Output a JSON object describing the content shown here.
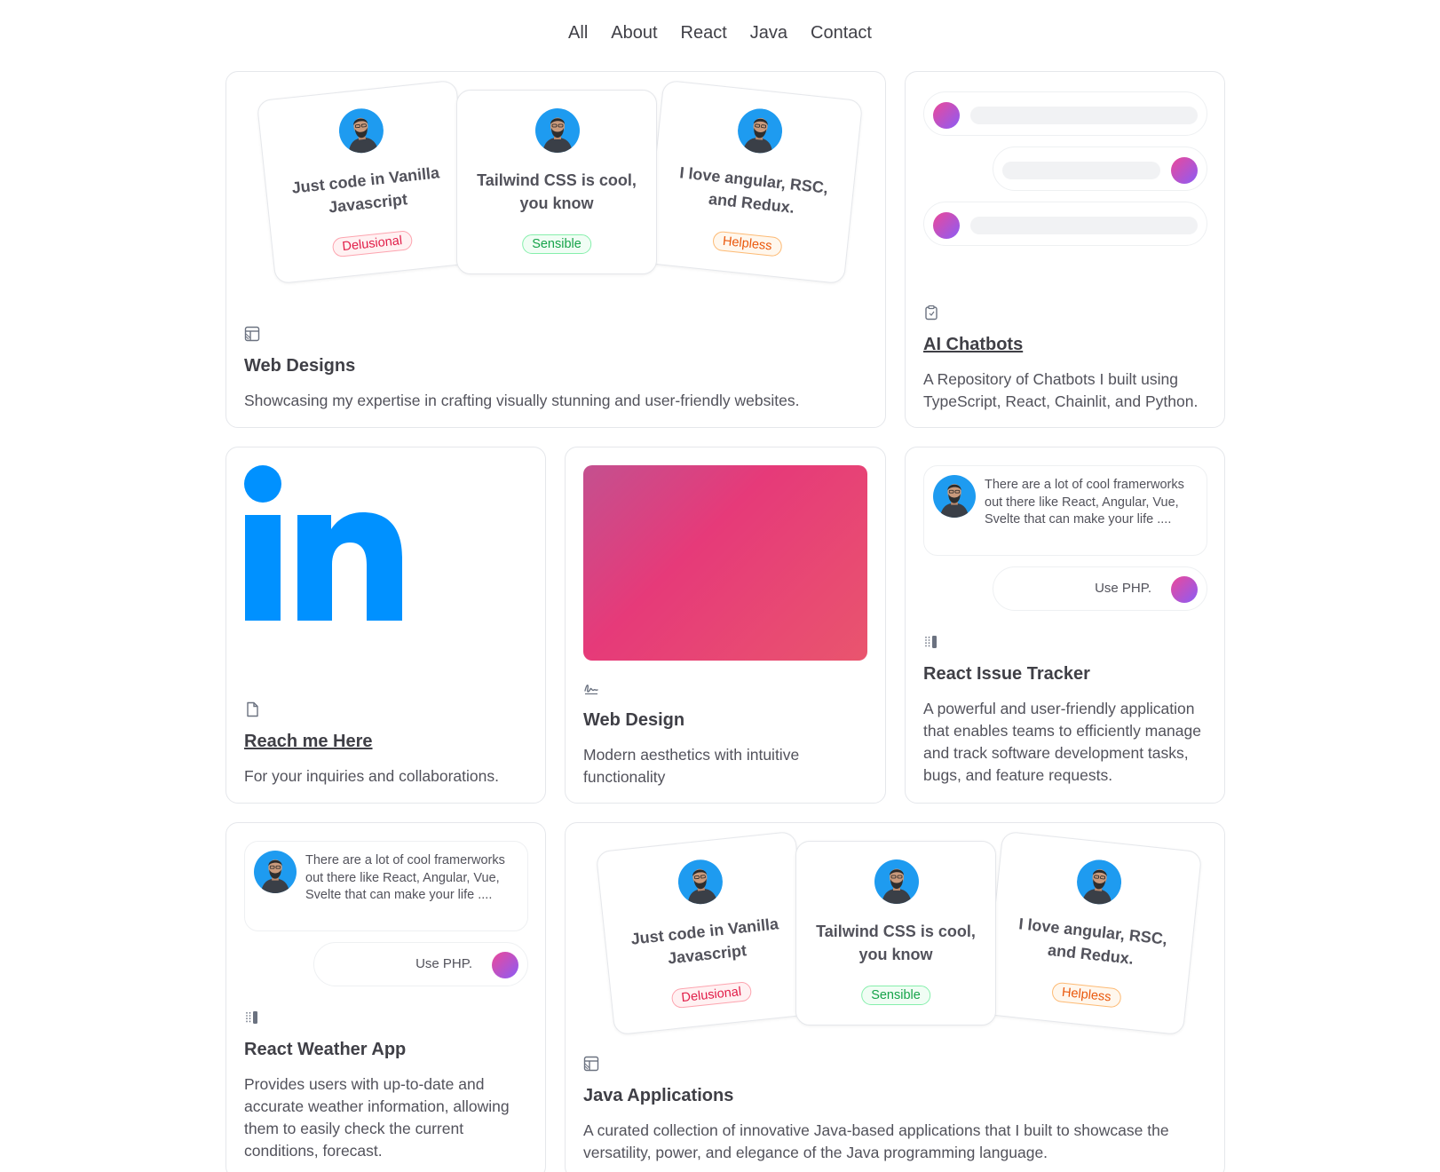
{
  "nav": {
    "items": [
      "All",
      "About",
      "React",
      "Java",
      "Contact"
    ]
  },
  "profile_cards": [
    {
      "text": "Just code in Vanilla Javascript",
      "badge": "Delusional"
    },
    {
      "text": "Tailwind CSS is cool, you know",
      "badge": "Sensible"
    },
    {
      "text": "I love angular, RSC, and Redux.",
      "badge": "Helpless"
    }
  ],
  "cards": {
    "web_designs": {
      "icon": "table-layout-icon",
      "title": "Web Designs",
      "desc": "Showcasing my expertise in crafting visually stunning and user-friendly websites."
    },
    "ai_chatbots": {
      "icon": "clipboard-icon",
      "title": "AI Chatbots",
      "desc": "A Repository of Chatbots I built using TypeScript, React, Chainlit, and Python."
    },
    "reach_me": {
      "icon": "file-icon",
      "title": "Reach me Here",
      "desc": "For your inquiries and collaborations.",
      "logo": "in"
    },
    "web_design": {
      "icon": "signature-icon",
      "title": "Web Design",
      "desc": "Modern aesthetics with intuitive functionality"
    },
    "react_issue": {
      "icon": "side-panel-icon",
      "title": "React Issue Tracker",
      "desc": "A powerful and user-friendly application that enables teams to efficiently manage and track software development tasks, bugs, and feature requests."
    },
    "react_weather": {
      "icon": "side-panel-icon",
      "title": "React Weather App",
      "desc": "Provides users with up-to-date and accurate weather information, allowing them to easily check the current conditions, forecast."
    },
    "java_apps": {
      "icon": "table-layout-icon",
      "title": "Java Applications",
      "desc": "A curated collection of innovative Java-based applications that I built to showcase the versatility, power, and elegance of the Java programming language."
    }
  },
  "chat": {
    "message": "There are a lot of cool framerworks out there like React, Angular, Vue, Svelte that can make your life ....",
    "reply": "Use PHP."
  },
  "colors": {
    "linkedin_blue": "#0091ff",
    "badge_red": "#e11d48",
    "badge_green": "#16a34a",
    "badge_orange": "#ea580c"
  }
}
